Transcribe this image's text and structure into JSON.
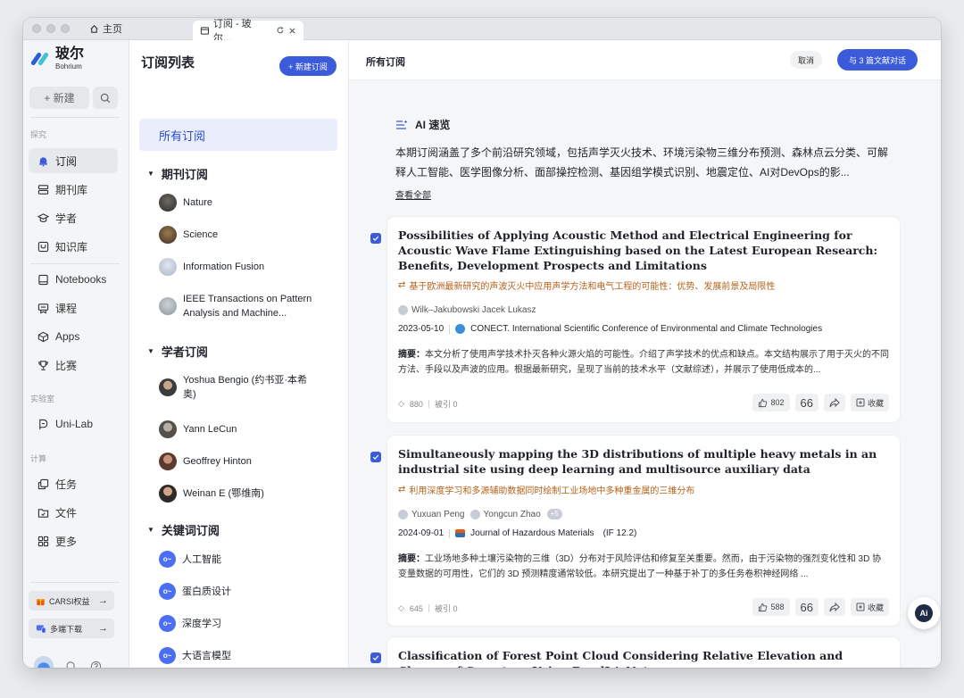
{
  "browser": {
    "home_tab": "主页",
    "active_tab": "订阅 - 玻尔..."
  },
  "brand": {
    "name_cn": "玻尔",
    "name_en": "Bohrium",
    "colors": [
      "#2b5fd9",
      "#3fc3d6",
      "#1f2a44"
    ]
  },
  "nav": {
    "new_label": "+ 新建",
    "section_explore": "探究",
    "section_lab": "实验室",
    "section_compute": "计算",
    "items": [
      {
        "label": "订阅",
        "icon": "bell-icon"
      },
      {
        "label": "期刊库",
        "icon": "journal-icon"
      },
      {
        "label": "学者",
        "icon": "scholar-icon"
      },
      {
        "label": "知识库",
        "icon": "knowledge-icon"
      },
      {
        "label": "Notebooks",
        "icon": "notebook-icon"
      },
      {
        "label": "课程",
        "icon": "course-icon"
      },
      {
        "label": "Apps",
        "icon": "apps-icon"
      },
      {
        "label": "比赛",
        "icon": "trophy-icon"
      },
      {
        "label": "Uni-Lab",
        "icon": "lab-icon"
      },
      {
        "label": "任务",
        "icon": "task-icon"
      },
      {
        "label": "文件",
        "icon": "folder-icon"
      },
      {
        "label": "更多",
        "icon": "grid-icon"
      }
    ],
    "promo_benefits": "CARSI权益",
    "promo_download": "多端下载"
  },
  "sublist": {
    "title": "订阅列表",
    "new_button": "+ 新建订阅",
    "all": "所有订阅",
    "groups": {
      "journals": {
        "title": "期刊订阅",
        "items": [
          "Nature",
          "Science",
          "Information Fusion",
          "IEEE Transactions on Pattern",
          "Analysis and Machine..."
        ]
      },
      "scholars": {
        "title": "学者订阅",
        "items": [
          "Yoshua Bengio (约书亚·本希",
          "奥)",
          "Yann LeCun",
          "Geoffrey Hinton",
          "Weinan E (鄂维南)"
        ]
      },
      "keywords": {
        "title": "关键词订阅",
        "items": [
          "人工智能",
          "蛋白质设计",
          "深度学习",
          "大语言模型"
        ]
      }
    }
  },
  "main": {
    "title": "所有订阅",
    "cancel": "取消",
    "chat": "与 3 篇文献对话",
    "ai": {
      "title": "AI 速览",
      "text": "本期订阅涵盖了多个前沿研究领域，包括声学灭火技术、环境污染物三维分布预测、森林点云分类、可解释人工智能、医学图像分析、面部操控检测、基因组学模式识别、地震定位、AI对DevOps的影...",
      "more": "查看全部"
    },
    "fab": "Ai",
    "papers": [
      {
        "title": "Possibilities of Applying Acoustic Method and Electrical Engineering for Acoustic Wave Flame Extinguishing based on the Latest European Research: Benefits, Development Prospects and Limitations",
        "translation": "基于欧洲最新研究的声波灭火中应用声学方法和电气工程的可能性：优势、发展前景及局限性",
        "authors": [
          "Wilk–Jakubowski Jacek Lukasz"
        ],
        "date": "2023-05-10",
        "venue": "CONECT. International Scientific Conference of Environmental and Climate Technologies",
        "impact": "",
        "abstract_label": "摘要：",
        "abstract": "本文分析了使用声学技术扑灭各种火源火焰的可能性。介绍了声学技术的优点和缺点。本文结构展示了用于灭火的不同方法、手段以及声波的应用。根据最新研究，呈现了当前的技术水平（文献综述），并展示了使用低成本的...",
        "views": "880",
        "cited": "被引 0",
        "likes": "802",
        "save": "收藏"
      },
      {
        "title": "Simultaneously mapping the 3D distributions of multiple heavy metals in an industrial site using deep learning and multisource auxiliary data",
        "translation": "利用深度学习和多源辅助数据同时绘制工业场地中多种重金属的三维分布",
        "authors": [
          "Yuxuan Peng",
          "Yongcun Zhao"
        ],
        "extra_authors": "+5",
        "date": "2024-09-01",
        "venue": "Journal of Hazardous Materials",
        "impact": "(IF 12.2)",
        "abstract_label": "摘要：",
        "abstract": "工业场地多种土壤污染物的三维（3D）分布对于风险评估和修复至关重要。然而，由于污染物的强烈变化性和 3D 协变量数据的可用性，它们的 3D 预测精度通常较低。本研究提出了一种基于补丁的多任务卷积神经网络 ...",
        "views": "645",
        "cited": "被引 0",
        "likes": "588",
        "save": "收藏"
      },
      {
        "title": "Classification of Forest Point Cloud Considering Relative Elevation and Change of Curvature Using RandLA-Net"
      }
    ]
  }
}
